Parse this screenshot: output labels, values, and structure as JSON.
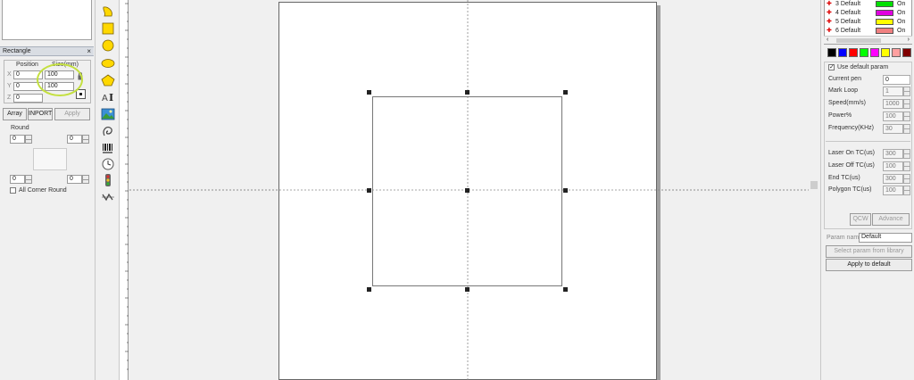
{
  "left_panel": {
    "title": "Rectangle",
    "close": "×",
    "position_header": "Position",
    "size_header": "Size(mm)",
    "x_label": "X",
    "x_pos": "0",
    "x_size": "100",
    "y_label": "Y",
    "y_pos": "0",
    "y_size": "100",
    "z_label": "Z",
    "z_pos": "0",
    "array_button": "Array",
    "input_button": "INPORT",
    "apply_button": "Apply",
    "round_label": "Round",
    "round_tl": "0",
    "round_tr": "0",
    "round_bl": "0",
    "round_br": "0",
    "all_corner_label": "All Corner Round"
  },
  "right_panel": {
    "pens": [
      {
        "name": "3 Default",
        "color": "#00e000",
        "state": "On"
      },
      {
        "name": "4 Default",
        "color": "#e000e0",
        "state": "On"
      },
      {
        "name": "5 Default",
        "color": "#ffff00",
        "state": "On"
      },
      {
        "name": "6 Default",
        "color": "#f08080",
        "state": "On"
      }
    ],
    "palette": [
      "#000000",
      "#0000ff",
      "#ff0000",
      "#00ff00",
      "#ff00ff",
      "#ffff00",
      "#ffa0a0",
      "#800000"
    ],
    "use_default_label": "Use default param",
    "params": [
      {
        "label": "Current pen",
        "value": "0",
        "enabled": true,
        "spin": false
      },
      {
        "label": "Mark Loop",
        "value": "1",
        "enabled": false,
        "spin": true
      },
      {
        "label": "Speed(mm/s)",
        "value": "1000",
        "enabled": false,
        "spin": true
      },
      {
        "label": "Power%",
        "value": "100",
        "enabled": false,
        "spin": true
      },
      {
        "label": "Frequency(KHz)",
        "value": "30",
        "enabled": false,
        "spin": true
      }
    ],
    "params2": [
      {
        "label": "Laser On TC(us)",
        "value": "300"
      },
      {
        "label": "Laser Off TC(us)",
        "value": "100"
      },
      {
        "label": "End TC(us)",
        "value": "300"
      },
      {
        "label": "Polygon TC(us)",
        "value": "100"
      }
    ],
    "qcw_button": "QCW",
    "advance_button": "Advance",
    "param_name_label": "Param name",
    "param_name_value": "Default",
    "select_param_button": "Select param from library",
    "apply_default_button": "Apply to default"
  }
}
